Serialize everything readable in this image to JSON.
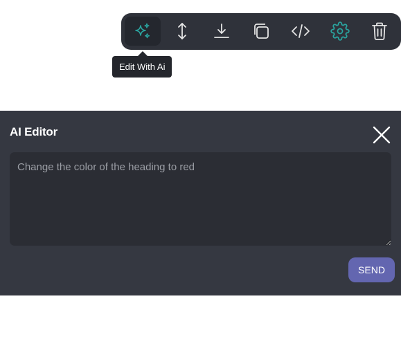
{
  "toolbar": {
    "buttons": [
      {
        "name": "edit-with-ai-button",
        "icon": "sparkles-icon",
        "active": true
      },
      {
        "name": "resize-vertical-button",
        "icon": "vertical-arrows-icon"
      },
      {
        "name": "download-button",
        "icon": "download-icon"
      },
      {
        "name": "duplicate-button",
        "icon": "copy-icon"
      },
      {
        "name": "code-button",
        "icon": "code-icon"
      },
      {
        "name": "settings-button",
        "icon": "gear-icon"
      },
      {
        "name": "delete-button",
        "icon": "trash-icon"
      }
    ],
    "tooltip": "Edit With Ai"
  },
  "editor": {
    "title": "AI Editor",
    "close_icon": "close-icon",
    "prompt_placeholder": "Change the color of the heading to red",
    "send_label": "SEND"
  },
  "colors": {
    "toolbar_bg": "#2f323a",
    "accent_teal": "#2aa5a0",
    "panel_bg": "#353841",
    "input_bg": "#2b2d34",
    "send_button": "#6366b0"
  }
}
